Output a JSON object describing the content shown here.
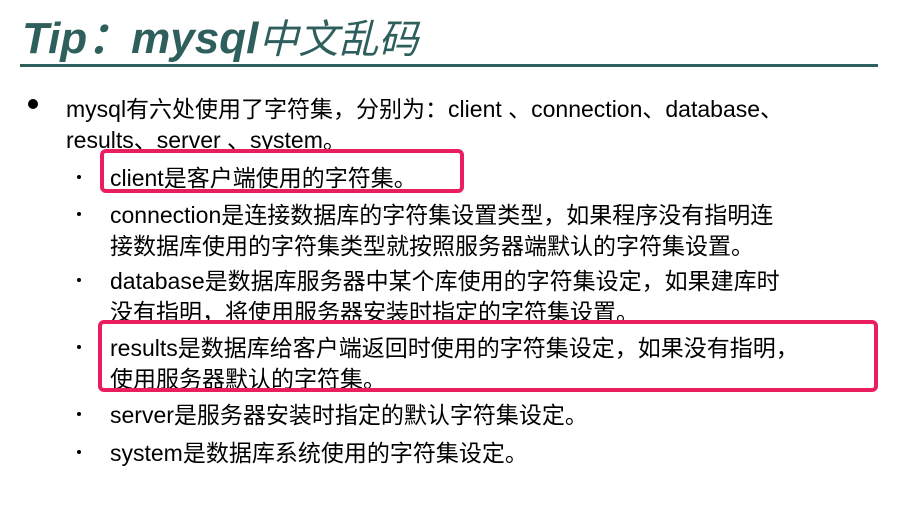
{
  "slide": {
    "title_en": "Tip：mysql",
    "title_cn": "中文乱码"
  },
  "main_bullet": {
    "line1": "mysql有六处使用了字符集，分别为：client 、connection、database、",
    "line2": "results、server 、system。"
  },
  "sub_items": [
    {
      "lines": [
        "client是客户端使用的字符集。"
      ]
    },
    {
      "lines": [
        "connection是连接数据库的字符集设置类型，如果程序没有指明连",
        "接数据库使用的字符集类型就按照服务器端默认的字符集设置。"
      ]
    },
    {
      "lines": [
        "database是数据库服务器中某个库使用的字符集设定，如果建库时",
        "没有指明，将使用服务器安装时指定的字符集设置。"
      ]
    },
    {
      "lines": [
        "results是数据库给客户端返回时使用的字符集设定，如果没有指明，",
        "使用服务器默认的字符集。"
      ]
    },
    {
      "lines": [
        "server是服务器安装时指定的默认字符集设定。"
      ]
    },
    {
      "lines": [
        "system是数据库系统使用的字符集设定。"
      ]
    }
  ],
  "colors": {
    "title": "#2e5f5c",
    "highlight": "#ea1e5e"
  }
}
